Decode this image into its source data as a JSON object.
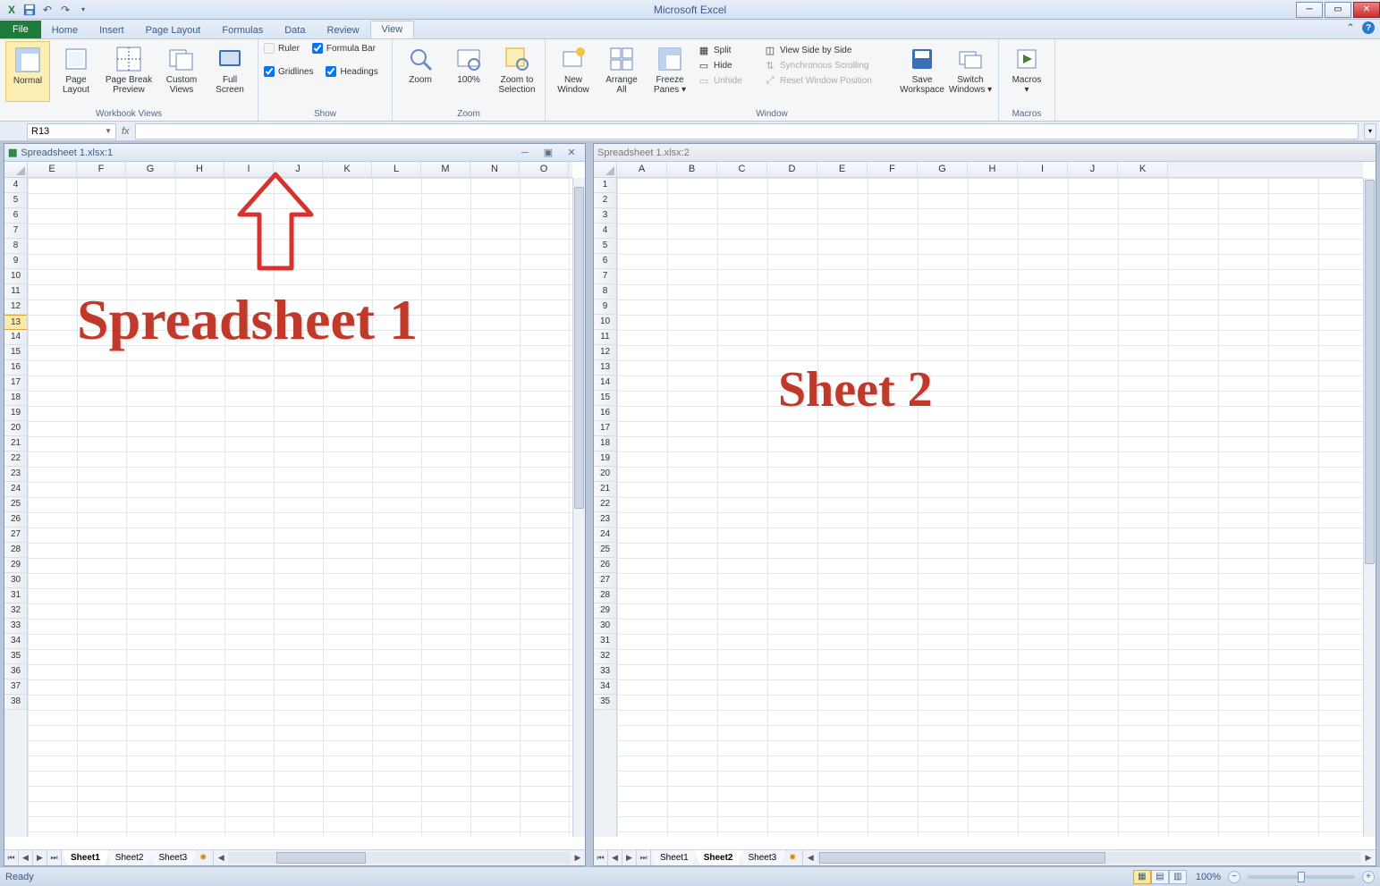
{
  "app_title": "Microsoft Excel",
  "qat": {
    "excel": "X",
    "save": "💾",
    "undo": "↶",
    "redo": "↷"
  },
  "tabs": [
    "File",
    "Home",
    "Insert",
    "Page Layout",
    "Formulas",
    "Data",
    "Review",
    "View"
  ],
  "active_tab": "View",
  "ribbon": {
    "workbook_views": {
      "label": "Workbook Views",
      "normal": "Normal",
      "page_layout": "Page\nLayout",
      "page_break": "Page Break\nPreview",
      "custom_views": "Custom\nViews",
      "full_screen": "Full\nScreen"
    },
    "show": {
      "label": "Show",
      "ruler": "Ruler",
      "gridlines": "Gridlines",
      "formula_bar": "Formula Bar",
      "headings": "Headings"
    },
    "zoom": {
      "label": "Zoom",
      "zoom": "Zoom",
      "hundred": "100%",
      "selection": "Zoom to\nSelection"
    },
    "window": {
      "label": "Window",
      "new_window": "New\nWindow",
      "arrange_all": "Arrange\nAll",
      "freeze_panes": "Freeze\nPanes ▾",
      "split": "Split",
      "hide": "Hide",
      "unhide": "Unhide",
      "side_by_side": "View Side by Side",
      "sync_scroll": "Synchronous Scrolling",
      "reset_pos": "Reset Window Position",
      "save_ws": "Save\nWorkspace",
      "switch_win": "Switch\nWindows ▾"
    },
    "macros_group": {
      "label": "Macros",
      "macros": "Macros\n▾"
    }
  },
  "namebox": "R13",
  "fx_label": "fx",
  "doc1": {
    "title": "Spreadsheet 1.xlsx:1",
    "cols": [
      "E",
      "F",
      "G",
      "H",
      "I",
      "J",
      "K",
      "L",
      "M",
      "N",
      "O"
    ],
    "row_start": 4,
    "row_end": 38,
    "selected_row": 13,
    "sheets": [
      "Sheet1",
      "Sheet2",
      "Sheet3"
    ],
    "active_sheet": "Sheet1",
    "annotation": "Spreadsheet 1"
  },
  "doc2": {
    "title": "Spreadsheet 1.xlsx:2",
    "cols": [
      "A",
      "B",
      "C",
      "D",
      "E",
      "F",
      "G",
      "H",
      "I",
      "J",
      "K"
    ],
    "row_start": 1,
    "row_end": 35,
    "sheets": [
      "Sheet1",
      "Sheet2",
      "Sheet3"
    ],
    "active_sheet": "Sheet2",
    "annotation": "Sheet 2"
  },
  "status": {
    "ready": "Ready",
    "zoom": "100%"
  }
}
